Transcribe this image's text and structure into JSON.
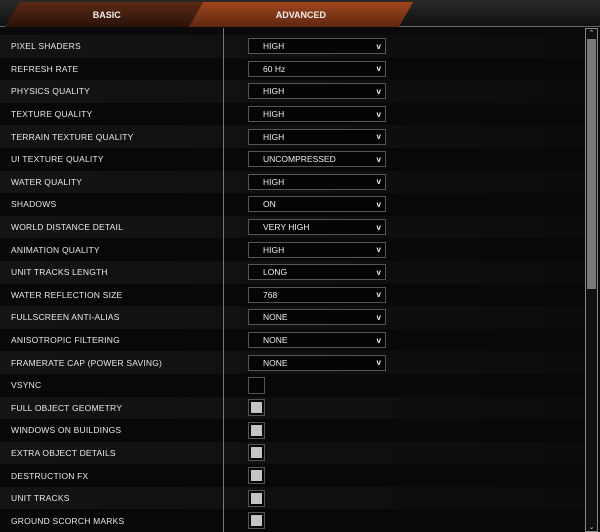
{
  "tabs": {
    "basic": "BASIC",
    "advanced": "ADVANCED",
    "active": "advanced"
  },
  "selects": [
    {
      "label": "PIXEL SHADERS",
      "value": "HIGH"
    },
    {
      "label": "REFRESH RATE",
      "value": "60 Hz"
    },
    {
      "label": "PHYSICS QUALITY",
      "value": "HIGH"
    },
    {
      "label": "TEXTURE QUALITY",
      "value": "HIGH"
    },
    {
      "label": "TERRAIN TEXTURE QUALITY",
      "value": "HIGH"
    },
    {
      "label": "UI TEXTURE QUALITY",
      "value": "UNCOMPRESSED"
    },
    {
      "label": "WATER QUALITY",
      "value": "HIGH"
    },
    {
      "label": "SHADOWS",
      "value": "ON"
    },
    {
      "label": "WORLD DISTANCE DETAIL",
      "value": "VERY HIGH"
    },
    {
      "label": "ANIMATION QUALITY",
      "value": "HIGH"
    },
    {
      "label": "UNIT TRACKS LENGTH",
      "value": "LONG"
    },
    {
      "label": "WATER REFLECTION SIZE",
      "value": "768"
    },
    {
      "label": "FULLSCREEN ANTI-ALIAS",
      "value": "NONE"
    },
    {
      "label": "ANISOTROPIC FILTERING",
      "value": "NONE"
    },
    {
      "label": "FRAMERATE CAP (POWER SAVING)",
      "value": "NONE"
    }
  ],
  "checkboxes": [
    {
      "label": "VSYNC",
      "checked": false
    },
    {
      "label": "FULL OBJECT GEOMETRY",
      "checked": true
    },
    {
      "label": "WINDOWS ON BUILDINGS",
      "checked": true
    },
    {
      "label": "EXTRA OBJECT DETAILS",
      "checked": true
    },
    {
      "label": "DESTRUCTION FX",
      "checked": true
    },
    {
      "label": "UNIT TRACKS",
      "checked": true
    },
    {
      "label": "GROUND SCORCH MARKS",
      "checked": true
    }
  ],
  "chevron": "v"
}
